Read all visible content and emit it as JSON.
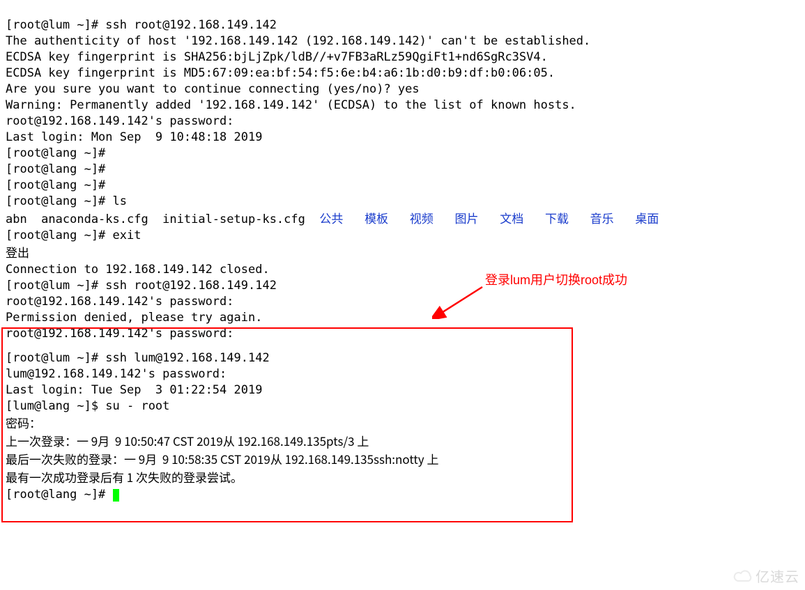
{
  "top": {
    "l1": "[root@lum ~]# ssh root@192.168.149.142",
    "l2": "The authenticity of host '192.168.149.142 (192.168.149.142)' can't be established.",
    "l3": "ECDSA key fingerprint is SHA256:bjLjZpk/ldB//+v7FB3aRLz59QgiFt1+nd6SgRc3SV4.",
    "l4": "ECDSA key fingerprint is MD5:67:09:ea:bf:54:f5:6e:b4:a6:1b:d0:b9:df:b0:06:05.",
    "l5": "Are you sure you want to continue connecting (yes/no)? yes",
    "l6": "Warning: Permanently added '192.168.149.142' (ECDSA) to the list of known hosts.",
    "l7": "root@192.168.149.142's password:",
    "l8": "Last login: Mon Sep  9 10:48:18 2019",
    "l9": "[root@lang ~]#",
    "l10": "[root@lang ~]#",
    "l11": "[root@lang ~]#",
    "l12": "[root@lang ~]# ls",
    "ls_prefix": "abn  anaconda-ks.cfg  initial-setup-ks.cfg  ",
    "ls_dirs": {
      "d1": "公共",
      "d2": "模板",
      "d3": "视频",
      "d4": "图片",
      "d5": "文档",
      "d6": "下载",
      "d7": "音乐",
      "d8": "桌面"
    },
    "l14": "[root@lang ~]# exit",
    "l15": "登出",
    "l16": "Connection to 192.168.149.142 closed.",
    "l17": "[root@lum ~]# ssh root@192.168.149.142",
    "l18": "root@192.168.149.142's password:",
    "l19": "Permission denied, please try again.",
    "l20": "root@192.168.149.142's password:"
  },
  "annotation": "登录lum用户切换root成功",
  "box": {
    "b1": "[root@lum ~]# ssh lum@192.168.149.142",
    "b2": "lum@192.168.149.142's password:",
    "b3": "Last login: Tue Sep  3 01:22:54 2019",
    "b4": "[lum@lang ~]$ su - root",
    "b5": "密码：",
    "b6": "上一次登录：一 9月  9 10:50:47 CST 2019从 192.168.149.135pts/3 上",
    "b7": "最后一次失败的登录：一 9月  9 10:58:35 CST 2019从 192.168.149.135ssh:notty 上",
    "b8": "最有一次成功登录后有 1 次失败的登录尝试。",
    "b9": "[root@lang ~]# "
  },
  "watermark_text": "亿速云"
}
